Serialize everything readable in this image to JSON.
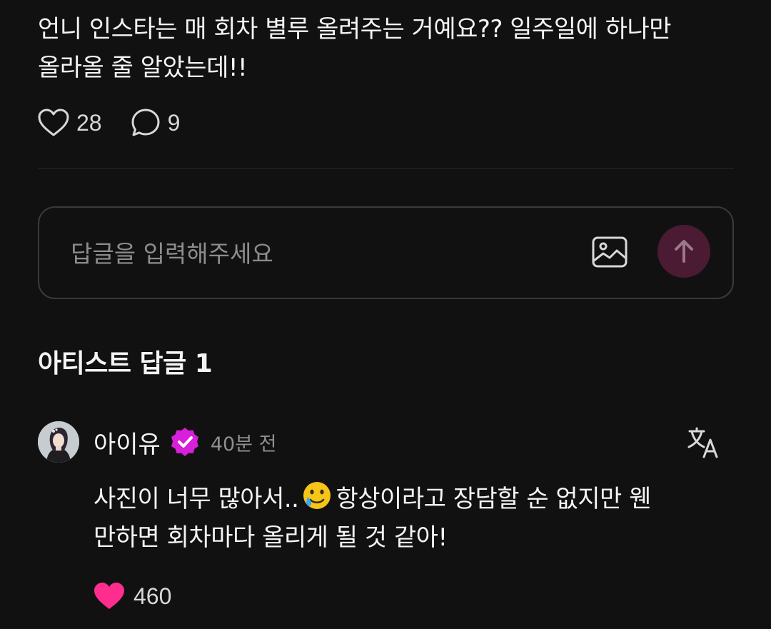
{
  "post": {
    "text_line1": "언니 인스타는 매 회차 별루 올려주는 거예요?? 일주일에 하나만",
    "text_line2": "올라올 줄 알았는데!!",
    "likes": "28",
    "comments": "9"
  },
  "reply": {
    "placeholder": "답글을 입력해주세요"
  },
  "artist_section": {
    "title": "아티스트 답글 1"
  },
  "artist_reply": {
    "author": "아이유",
    "time": "40분 전",
    "text_line1_part1": "사진이 너무 많아서..",
    "text_line1_part2": "항상이라고 장담할 순 없지만 웬",
    "text_line2": "만하면 회차마다 올리게 될 것 같아!",
    "emoji": "smiling-face-with-tear",
    "likes": "460"
  },
  "colors": {
    "background": "#121112",
    "send_button": "#4b1a33",
    "verified_badge": "#d81fd9",
    "liked_heart": "#ff2d8e"
  },
  "icons": {
    "like": "heart-outline-icon",
    "comment": "speech-bubble-icon",
    "image": "image-icon",
    "send": "arrow-up-icon",
    "verified": "verified-badge-icon",
    "translate": "translate-icon",
    "liked": "heart-filled-icon"
  }
}
